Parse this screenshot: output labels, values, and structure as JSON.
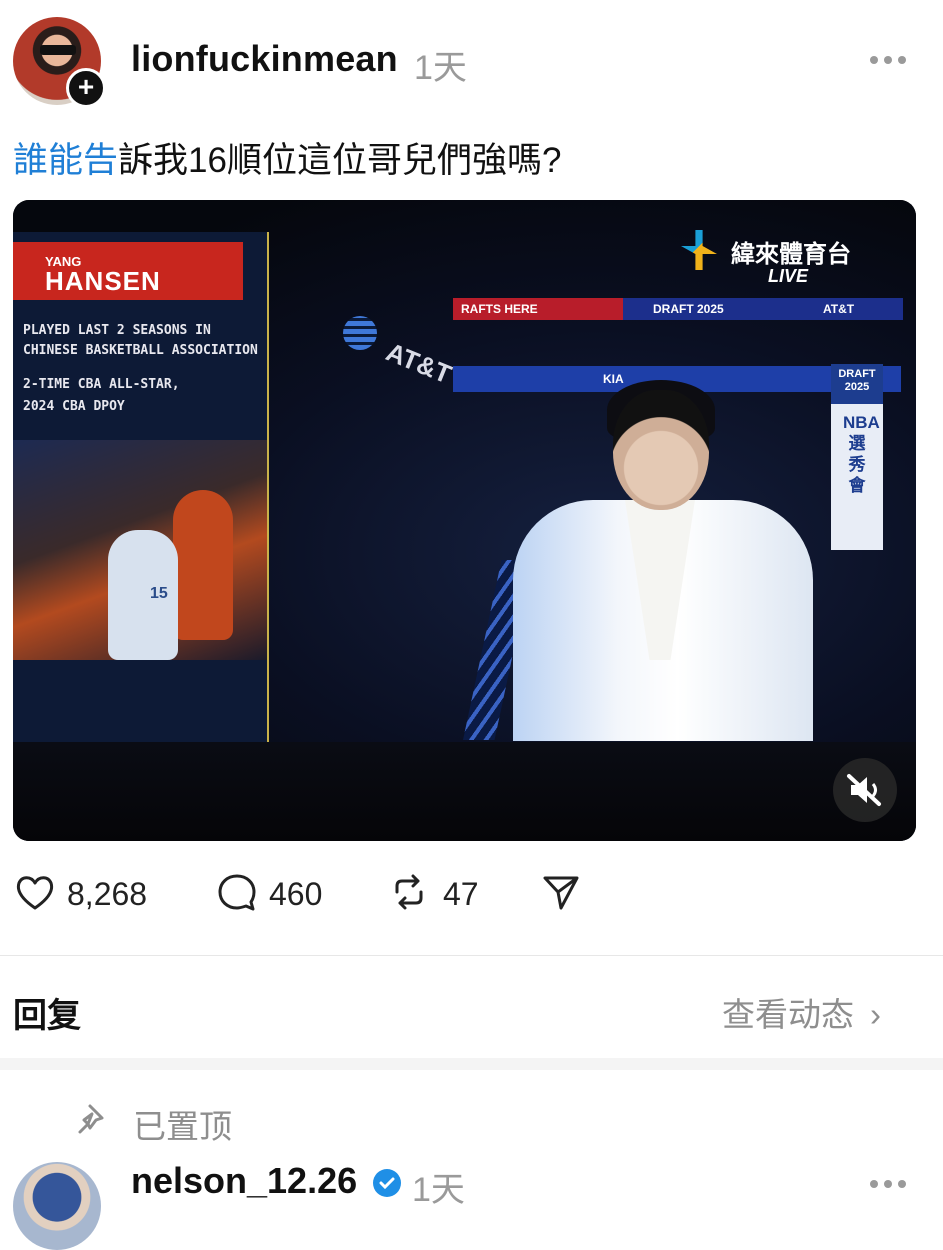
{
  "post": {
    "username": "lionfuckinmean",
    "time_ago": "1天",
    "text_link": "誰能告",
    "text_rest": "訴我16順位這位哥兒們強嗎?"
  },
  "video": {
    "panel": {
      "first_name": "YANG",
      "last_name": "HANSEN",
      "line1": "PLAYED LAST 2 SEASONS IN",
      "line2": "CHINESE BASKETBALL ASSOCIATION",
      "line3": "2-TIME CBA ALL-STAR,",
      "line4": "2024 CBA DPOY",
      "jersey_number": "15"
    },
    "broadcaster": "緯來體育台",
    "live_label": "LIVE",
    "att_label": "AT&T",
    "ribbon_top_left": "RAFTS HERE",
    "ribbon_top_mid": "DRAFT 2025",
    "ribbon_top_right": "AT&T",
    "ribbon_bottom": "KIA",
    "banner_top": "DRAFT 2025",
    "banner_vertical": "NBA選秀會",
    "mute_icon": "speaker-muted-icon"
  },
  "actions": {
    "likes": "8,268",
    "comments": "460",
    "reposts": "47"
  },
  "replies_section": {
    "title": "回复",
    "view_activity": "查看动态",
    "pinned_label": "已置顶"
  },
  "reply": {
    "username": "nelson_12.26",
    "time_ago": "1天"
  }
}
